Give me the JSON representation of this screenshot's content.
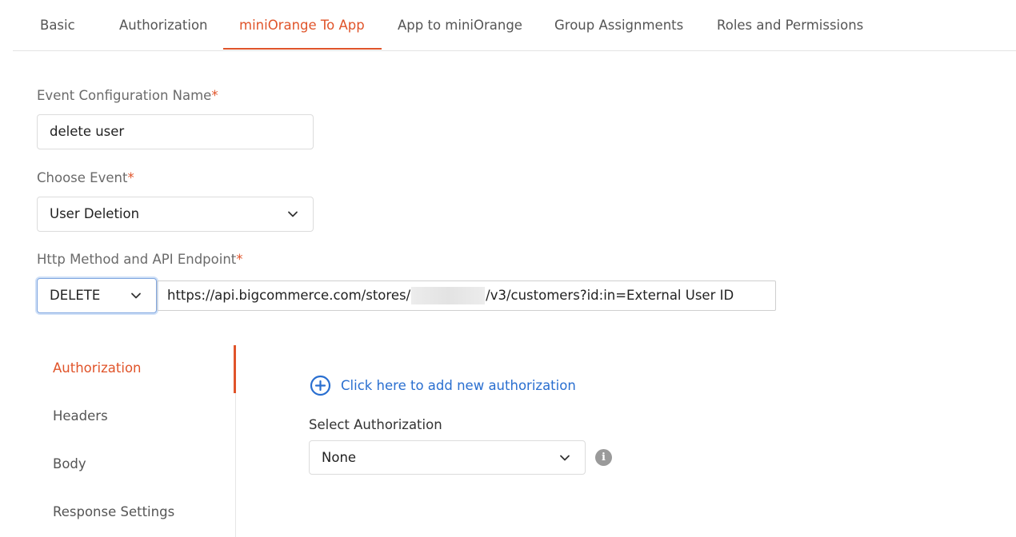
{
  "tabs": [
    {
      "label": "Basic",
      "active": false
    },
    {
      "label": "Authorization",
      "active": false
    },
    {
      "label": "miniOrange To App",
      "active": true
    },
    {
      "label": "App to miniOrange",
      "active": false
    },
    {
      "label": "Group Assignments",
      "active": false
    },
    {
      "label": "Roles and Permissions",
      "active": false
    }
  ],
  "form": {
    "event_config_label": "Event Configuration Name",
    "event_config_value": "delete user",
    "choose_event_label": "Choose Event",
    "choose_event_value": "User Deletion",
    "http_label": "Http Method and API Endpoint",
    "http_method": "DELETE",
    "endpoint_prefix": "https://api.bigcommerce.com/stores/",
    "endpoint_suffix": "/v3/customers?id:in=External User ID",
    "required_mark": "*"
  },
  "side_menu": [
    {
      "label": "Authorization",
      "active": true
    },
    {
      "label": "Headers",
      "active": false
    },
    {
      "label": "Body",
      "active": false
    },
    {
      "label": "Response Settings",
      "active": false
    }
  ],
  "auth_panel": {
    "add_link": "Click here to add new authorization",
    "select_label": "Select Authorization",
    "select_value": "None",
    "info_glyph": "i"
  },
  "colors": {
    "accent": "#e0542a",
    "link": "#2a6fd0",
    "focus_border": "#7fa6e0"
  },
  "icons": {
    "chevron": "chevron-down-icon",
    "add": "plus-circle-icon",
    "info": "info-icon"
  }
}
